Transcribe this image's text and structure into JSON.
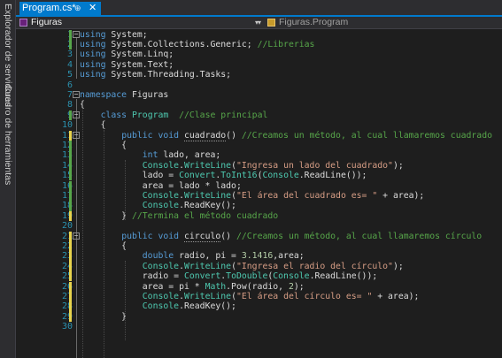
{
  "side_tabs": {
    "server_explorer": "Explorador de servidores",
    "toolbox": "Cuadro de herramientas"
  },
  "document_tab": {
    "title": "Program.cs*",
    "pin": "⊕",
    "close": "✕"
  },
  "navigation": {
    "project": "Figuras",
    "scope": "Figuras.Program"
  },
  "editor": {
    "lines": [
      {
        "n": "1",
        "chg": "green",
        "fold": "minus",
        "tokens": [
          [
            "kw",
            "using"
          ],
          [
            "tx",
            " System;"
          ]
        ]
      },
      {
        "n": "2",
        "chg": "green",
        "fold": "",
        "tokens": [
          [
            "kw",
            "using"
          ],
          [
            "tx",
            " System.Collections.Generic; "
          ],
          [
            "cm",
            "//Librerias"
          ]
        ]
      },
      {
        "n": "3",
        "chg": "",
        "fold": "",
        "tokens": [
          [
            "kw",
            "using"
          ],
          [
            "tx",
            " System.Linq;"
          ]
        ]
      },
      {
        "n": "4",
        "chg": "",
        "fold": "",
        "tokens": [
          [
            "kw",
            "using"
          ],
          [
            "tx",
            " System.Text;"
          ]
        ]
      },
      {
        "n": "5",
        "chg": "",
        "fold": "",
        "tokens": [
          [
            "kw",
            "using"
          ],
          [
            "tx",
            " System.Threading.Tasks;"
          ]
        ]
      },
      {
        "n": "6",
        "chg": "",
        "fold": "",
        "tokens": []
      },
      {
        "n": "7",
        "chg": "",
        "fold": "minus",
        "tokens": [
          [
            "kw",
            "namespace"
          ],
          [
            "tx",
            " Figuras"
          ]
        ]
      },
      {
        "n": "8",
        "chg": "",
        "fold": "",
        "tokens": [
          [
            "tx",
            "{"
          ]
        ]
      },
      {
        "n": "9",
        "chg": "green",
        "fold": "minus",
        "tokens": [
          [
            "tx",
            "    "
          ],
          [
            "kw",
            "class"
          ],
          [
            "tx",
            " "
          ],
          [
            "ty",
            "Program"
          ],
          [
            "tx",
            "  "
          ],
          [
            "cm",
            "//Clase principal"
          ]
        ]
      },
      {
        "n": "10",
        "chg": "",
        "fold": "",
        "tokens": [
          [
            "tx",
            "    {"
          ]
        ]
      },
      {
        "n": "11",
        "chg": "yellow",
        "fold": "minus",
        "tokens": [
          [
            "tx",
            "        "
          ],
          [
            "kw",
            "public"
          ],
          [
            "tx",
            " "
          ],
          [
            "kw",
            "void"
          ],
          [
            "tx",
            " "
          ],
          [
            "ul",
            "cuadrado"
          ],
          [
            "tx",
            "() "
          ],
          [
            "cm",
            "//Creamos un método, al cual llamaremos cuadrado"
          ]
        ]
      },
      {
        "n": "12",
        "chg": "green",
        "fold": "",
        "tokens": [
          [
            "tx",
            "        {"
          ]
        ]
      },
      {
        "n": "13",
        "chg": "green",
        "fold": "",
        "tokens": [
          [
            "tx",
            "            "
          ],
          [
            "kw",
            "int"
          ],
          [
            "tx",
            " lado, area;"
          ]
        ]
      },
      {
        "n": "14",
        "chg": "green",
        "fold": "",
        "tokens": [
          [
            "tx",
            "            "
          ],
          [
            "ty",
            "Console"
          ],
          [
            "tx",
            "."
          ],
          [
            "ty",
            "WriteLine"
          ],
          [
            "tx",
            "("
          ],
          [
            "st",
            "\"Ingresa un lado del cuadrado\""
          ],
          [
            "tx",
            ");"
          ]
        ]
      },
      {
        "n": "15",
        "chg": "green",
        "fold": "",
        "tokens": [
          [
            "tx",
            "            lado = "
          ],
          [
            "ty",
            "Convert"
          ],
          [
            "tx",
            "."
          ],
          [
            "ty",
            "ToInt16"
          ],
          [
            "tx",
            "("
          ],
          [
            "ty",
            "Console"
          ],
          [
            "tx",
            ".ReadLine());"
          ]
        ]
      },
      {
        "n": "16",
        "chg": "green",
        "fold": "",
        "tokens": [
          [
            "tx",
            "            area = lado * lado;"
          ]
        ]
      },
      {
        "n": "17",
        "chg": "green",
        "fold": "",
        "tokens": [
          [
            "tx",
            "            "
          ],
          [
            "ty",
            "Console"
          ],
          [
            "tx",
            "."
          ],
          [
            "ty",
            "WriteLine"
          ],
          [
            "tx",
            "("
          ],
          [
            "st",
            "\"El área del cuadrado es= \""
          ],
          [
            "tx",
            " + area);"
          ]
        ]
      },
      {
        "n": "18",
        "chg": "green",
        "fold": "",
        "tokens": [
          [
            "tx",
            "            "
          ],
          [
            "ty",
            "Console"
          ],
          [
            "tx",
            ".ReadKey();"
          ]
        ]
      },
      {
        "n": "19",
        "chg": "yellow",
        "fold": "",
        "tokens": [
          [
            "tx",
            "        } "
          ],
          [
            "cm",
            "//Termina el método cuadrado"
          ]
        ]
      },
      {
        "n": "20",
        "chg": "",
        "fold": "",
        "tokens": []
      },
      {
        "n": "21",
        "chg": "yellow",
        "fold": "minus",
        "tokens": [
          [
            "tx",
            "        "
          ],
          [
            "kw",
            "public"
          ],
          [
            "tx",
            " "
          ],
          [
            "kw",
            "void"
          ],
          [
            "tx",
            " "
          ],
          [
            "ul",
            "circulo"
          ],
          [
            "tx",
            "() "
          ],
          [
            "cm",
            "//Creamos un método, al cual llamaremos círculo"
          ]
        ]
      },
      {
        "n": "22",
        "chg": "yellow",
        "fold": "",
        "tokens": [
          [
            "tx",
            "        {"
          ]
        ]
      },
      {
        "n": "23",
        "chg": "yellow",
        "fold": "",
        "tokens": [
          [
            "tx",
            "            "
          ],
          [
            "kw",
            "double"
          ],
          [
            "tx",
            " radio, pi = "
          ],
          [
            "nm",
            "3.1416"
          ],
          [
            "tx",
            ",area;"
          ]
        ]
      },
      {
        "n": "24",
        "chg": "yellow",
        "fold": "",
        "tokens": [
          [
            "tx",
            "            "
          ],
          [
            "ty",
            "Console"
          ],
          [
            "tx",
            "."
          ],
          [
            "ty",
            "WriteLine"
          ],
          [
            "tx",
            "("
          ],
          [
            "st",
            "\"Ingresa el radio del círculo\""
          ],
          [
            "tx",
            ");"
          ]
        ]
      },
      {
        "n": "25",
        "chg": "yellow",
        "fold": "",
        "tokens": [
          [
            "tx",
            "            radio = "
          ],
          [
            "ty",
            "Convert"
          ],
          [
            "tx",
            "."
          ],
          [
            "ty",
            "ToDouble"
          ],
          [
            "tx",
            "("
          ],
          [
            "ty",
            "Console"
          ],
          [
            "tx",
            ".ReadLine());"
          ]
        ]
      },
      {
        "n": "26",
        "chg": "yellow",
        "fold": "",
        "tokens": [
          [
            "tx",
            "            area = pi * "
          ],
          [
            "ty",
            "Math"
          ],
          [
            "tx",
            ".Pow(radio, "
          ],
          [
            "nm",
            "2"
          ],
          [
            "tx",
            ");"
          ]
        ]
      },
      {
        "n": "27",
        "chg": "yellow",
        "fold": "",
        "tokens": [
          [
            "tx",
            "            "
          ],
          [
            "ty",
            "Console"
          ],
          [
            "tx",
            "."
          ],
          [
            "ty",
            "WriteLine"
          ],
          [
            "tx",
            "("
          ],
          [
            "st",
            "\"El área del círculo es= \""
          ],
          [
            "tx",
            " + area);"
          ]
        ]
      },
      {
        "n": "28",
        "chg": "yellow",
        "fold": "",
        "tokens": [
          [
            "tx",
            "            "
          ],
          [
            "ty",
            "Console"
          ],
          [
            "tx",
            ".ReadKey();"
          ]
        ]
      },
      {
        "n": "29",
        "chg": "yellow",
        "fold": "",
        "tokens": [
          [
            "tx",
            "        }"
          ]
        ]
      },
      {
        "n": "30",
        "chg": "",
        "fold": "",
        "tokens": []
      }
    ]
  }
}
